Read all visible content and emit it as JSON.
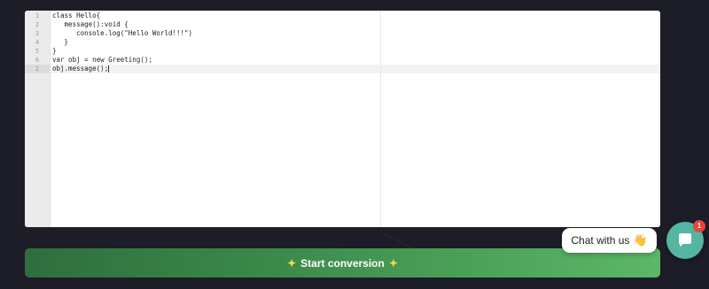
{
  "editor": {
    "line_numbers": [
      "1",
      "2",
      "3",
      "4",
      "5",
      "6",
      "2"
    ],
    "lines": [
      "class Hello{",
      "   message():void {",
      "      console.log(\"Hello World!!!\")",
      "   }",
      "}",
      "var obj = new Greeting();",
      "obj.message();"
    ]
  },
  "convert_button": {
    "label": "Start conversion",
    "sparkle_left": "✦",
    "sparkle_right": "✦"
  },
  "chat": {
    "bubble_text": "Chat with us",
    "wave_icon": "👋",
    "badge_count": "1"
  },
  "colors": {
    "background": "#1c1d27",
    "button_gradient_start": "#2f6e3d",
    "button_gradient_end": "#5bb866",
    "chat_launcher": "#55b5a0",
    "badge": "#e2463c"
  }
}
